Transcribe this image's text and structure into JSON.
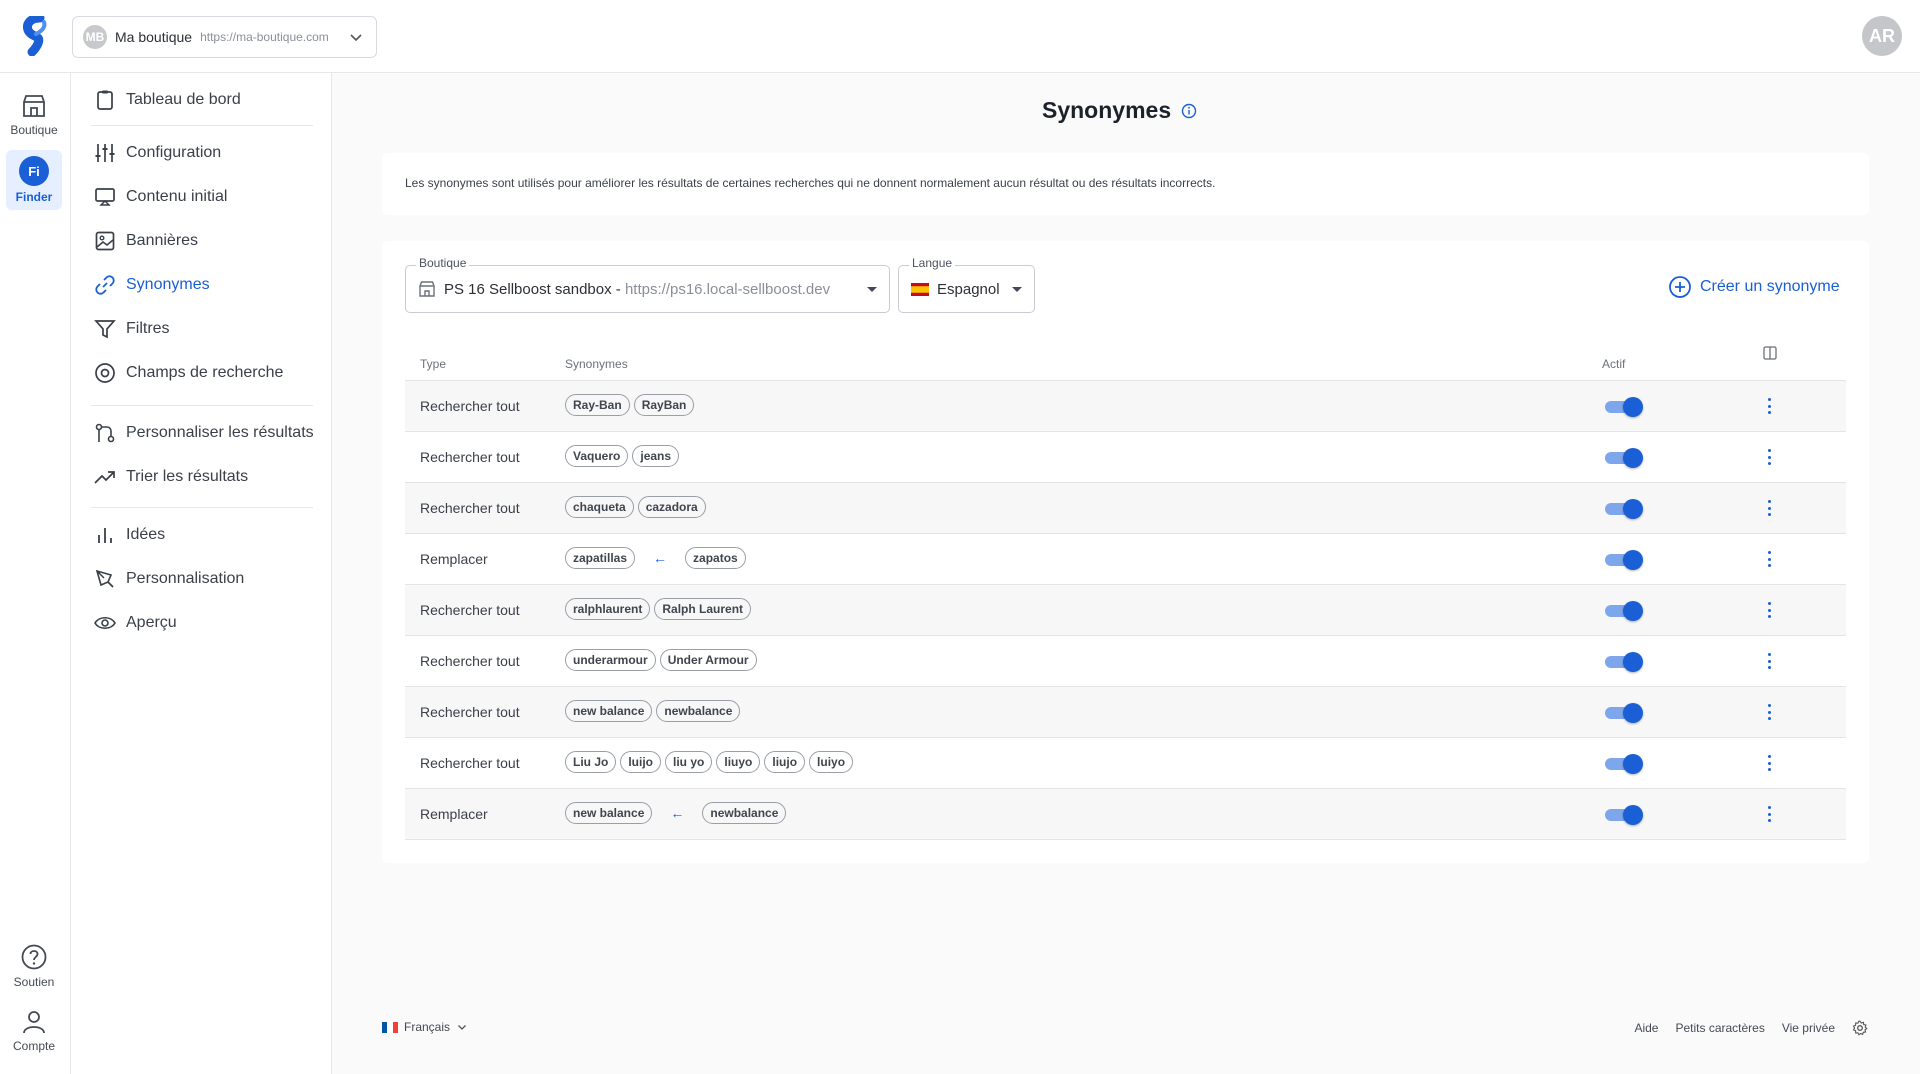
{
  "topbar": {
    "shop_initials": "MB",
    "shop_name": "Ma boutique",
    "shop_url": "https://ma-boutique.com",
    "user_initials": "AR"
  },
  "rail": {
    "boutique": "Boutique",
    "finder": "Finder",
    "finder_badge": "Fi",
    "soutien": "Soutien",
    "compte": "Compte"
  },
  "sidebar": {
    "items": [
      {
        "label": "Tableau de bord"
      },
      {
        "label": "Configuration"
      },
      {
        "label": "Contenu initial"
      },
      {
        "label": "Bannières"
      },
      {
        "label": "Synonymes"
      },
      {
        "label": "Filtres"
      },
      {
        "label": "Champs de recherche"
      },
      {
        "label": "Personnaliser les résultats"
      },
      {
        "label": "Trier les résultats"
      },
      {
        "label": "Idées"
      },
      {
        "label": "Personnalisation"
      },
      {
        "label": "Aperçu"
      }
    ]
  },
  "page": {
    "title": "Synonymes",
    "description": "Les synonymes sont utilisés pour améliorer les résultats de certaines recherches qui ne donnent normalement aucun résultat ou des résultats incorrects."
  },
  "filters": {
    "boutique_label": "Boutique",
    "boutique_name": "PS 16 Sellboost sandbox",
    "boutique_sep": " - ",
    "boutique_url": "https://ps16.local-sellboost.dev",
    "langue_label": "Langue",
    "langue_value": "Espagnol",
    "create_label": "Créer un synonyme"
  },
  "table": {
    "headers": {
      "type": "Type",
      "synonymes": "Synonymes",
      "actif": "Actif"
    },
    "rows": [
      {
        "type": "Rechercher tout",
        "replace": false,
        "chips": [
          "Ray-Ban",
          "RayBan"
        ],
        "active": true
      },
      {
        "type": "Rechercher tout",
        "replace": false,
        "chips": [
          "Vaquero",
          "jeans"
        ],
        "active": true
      },
      {
        "type": "Rechercher tout",
        "replace": false,
        "chips": [
          "chaqueta",
          "cazadora"
        ],
        "active": true
      },
      {
        "type": "Remplacer",
        "replace": true,
        "chips": [
          "zapatillas",
          "zapatos"
        ],
        "active": true
      },
      {
        "type": "Rechercher tout",
        "replace": false,
        "chips": [
          "ralphlaurent",
          "Ralph Laurent"
        ],
        "active": true
      },
      {
        "type": "Rechercher tout",
        "replace": false,
        "chips": [
          "underarmour",
          "Under Armour"
        ],
        "active": true
      },
      {
        "type": "Rechercher tout",
        "replace": false,
        "chips": [
          "new balance",
          "newbalance"
        ],
        "active": true
      },
      {
        "type": "Rechercher tout",
        "replace": false,
        "chips": [
          "Liu Jo",
          "luijo",
          "liu yo",
          "liuyo",
          "liujo",
          "luiyo"
        ],
        "active": true
      },
      {
        "type": "Remplacer",
        "replace": true,
        "chips": [
          "new balance",
          "newbalance"
        ],
        "active": true
      }
    ]
  },
  "footer": {
    "language": "Français",
    "links": [
      "Aide",
      "Petits caractères",
      "Vie privée"
    ]
  },
  "colors": {
    "accent": "#1a5fd6"
  }
}
